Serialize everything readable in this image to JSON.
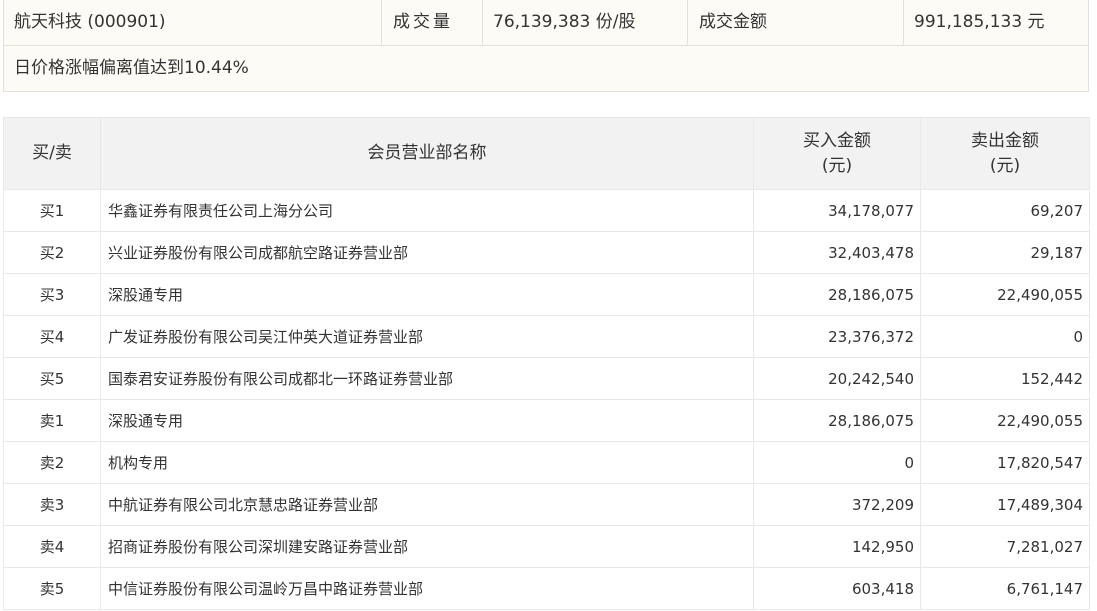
{
  "summary": {
    "stock": "航天科技 (000901)",
    "volume_label": "成交量",
    "volume_value": "76,139,383 份/股",
    "amount_label": "成交金额",
    "amount_value": "991,185,133 元",
    "reason": "日价格涨幅偏离值达到10.44%"
  },
  "table": {
    "headers": {
      "side": "买/卖",
      "name": "会员营业部名称",
      "buy_line1": "买入金额",
      "buy_line2": "(元)",
      "sell_line1": "卖出金额",
      "sell_line2": "(元)"
    },
    "rows": [
      {
        "side": "买1",
        "name": "华鑫证券有限责任公司上海分公司",
        "buy": "34,178,077",
        "sell": "69,207"
      },
      {
        "side": "买2",
        "name": "兴业证券股份有限公司成都航空路证券营业部",
        "buy": "32,403,478",
        "sell": "29,187"
      },
      {
        "side": "买3",
        "name": "深股通专用",
        "buy": "28,186,075",
        "sell": "22,490,055"
      },
      {
        "side": "买4",
        "name": "广发证券股份有限公司吴江仲英大道证券营业部",
        "buy": "23,376,372",
        "sell": "0"
      },
      {
        "side": "买5",
        "name": "国泰君安证券股份有限公司成都北一环路证券营业部",
        "buy": "20,242,540",
        "sell": "152,442"
      },
      {
        "side": "卖1",
        "name": "深股通专用",
        "buy": "28,186,075",
        "sell": "22,490,055"
      },
      {
        "side": "卖2",
        "name": "机构专用",
        "buy": "0",
        "sell": "17,820,547"
      },
      {
        "side": "卖3",
        "name": "中航证券有限公司北京慧忠路证券营业部",
        "buy": "372,209",
        "sell": "17,489,304"
      },
      {
        "side": "卖4",
        "name": "招商证券股份有限公司深圳建安路证券营业部",
        "buy": "142,950",
        "sell": "7,281,027"
      },
      {
        "side": "卖5",
        "name": "中信证券股份有限公司温岭万昌中路证券营业部",
        "buy": "603,418",
        "sell": "6,761,147"
      }
    ]
  }
}
